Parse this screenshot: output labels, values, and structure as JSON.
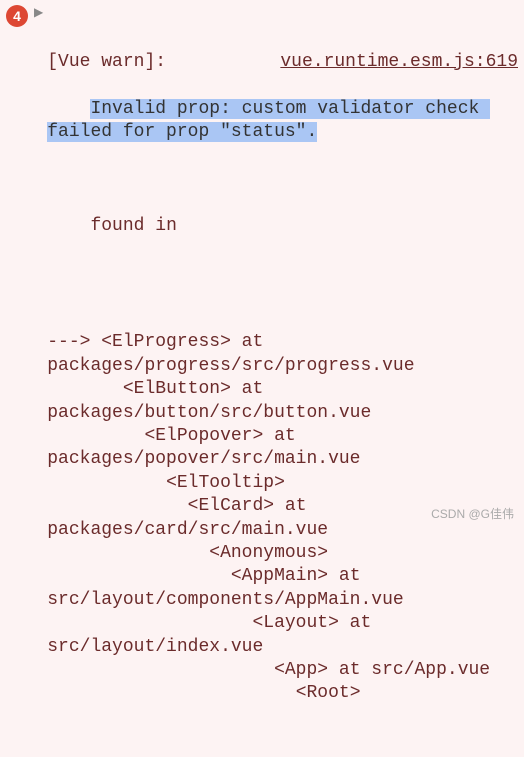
{
  "badge_count": "4",
  "warn_prefix": "[Vue warn]:",
  "source_link": "vue.runtime.esm.js:619",
  "highlighted_message": "Invalid prop: custom validator check failed for prop \"status\".",
  "found_in": "found in",
  "trace": [
    "---> <ElProgress> at packages/progress/src/progress.vue",
    "       <ElButton> at packages/button/src/button.vue",
    "         <ElPopover> at packages/popover/src/main.vue",
    "           <ElTooltip>",
    "             <ElCard> at packages/card/src/main.vue",
    "               <Anonymous>",
    "                 <AppMain> at src/layout/components/AppMain.vue",
    "                   <Layout> at src/layout/index.vue",
    "                     <App> at src/App.vue",
    "                       <Root>"
  ],
  "watermark": "CSDN @G佳伟"
}
